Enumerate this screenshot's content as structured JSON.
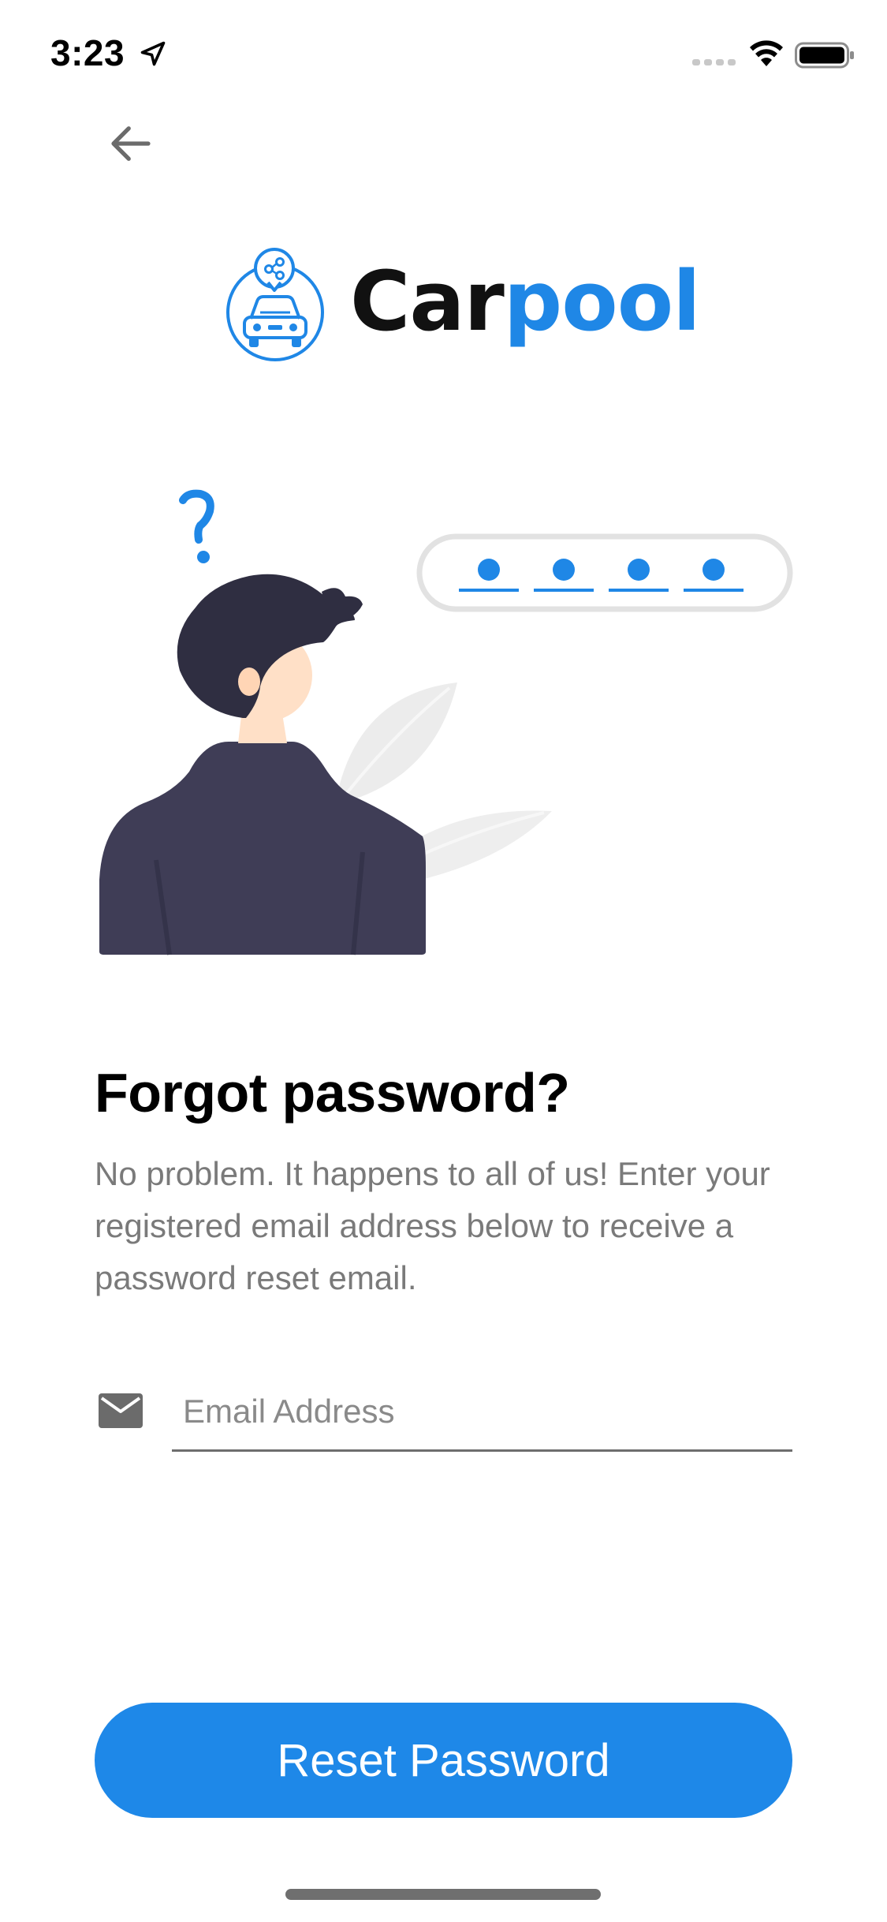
{
  "status_bar": {
    "time": "3:23"
  },
  "header": {
    "back_icon": "arrow-left-icon"
  },
  "logo": {
    "text_dark": "Car",
    "text_blue": "pool",
    "icon": "car-share-icon"
  },
  "colors": {
    "accent": "#1e88e8",
    "logo_blue": "#1f87e6",
    "text_muted": "#7a7a7a"
  },
  "main": {
    "title": "Forgot password?",
    "description": "No problem. It happens to all of us! Enter your registered email address below to receive a password reset email.",
    "email": {
      "icon": "envelope-icon",
      "placeholder": "Email Address",
      "value": ""
    },
    "reset_button_label": "Reset Password"
  }
}
